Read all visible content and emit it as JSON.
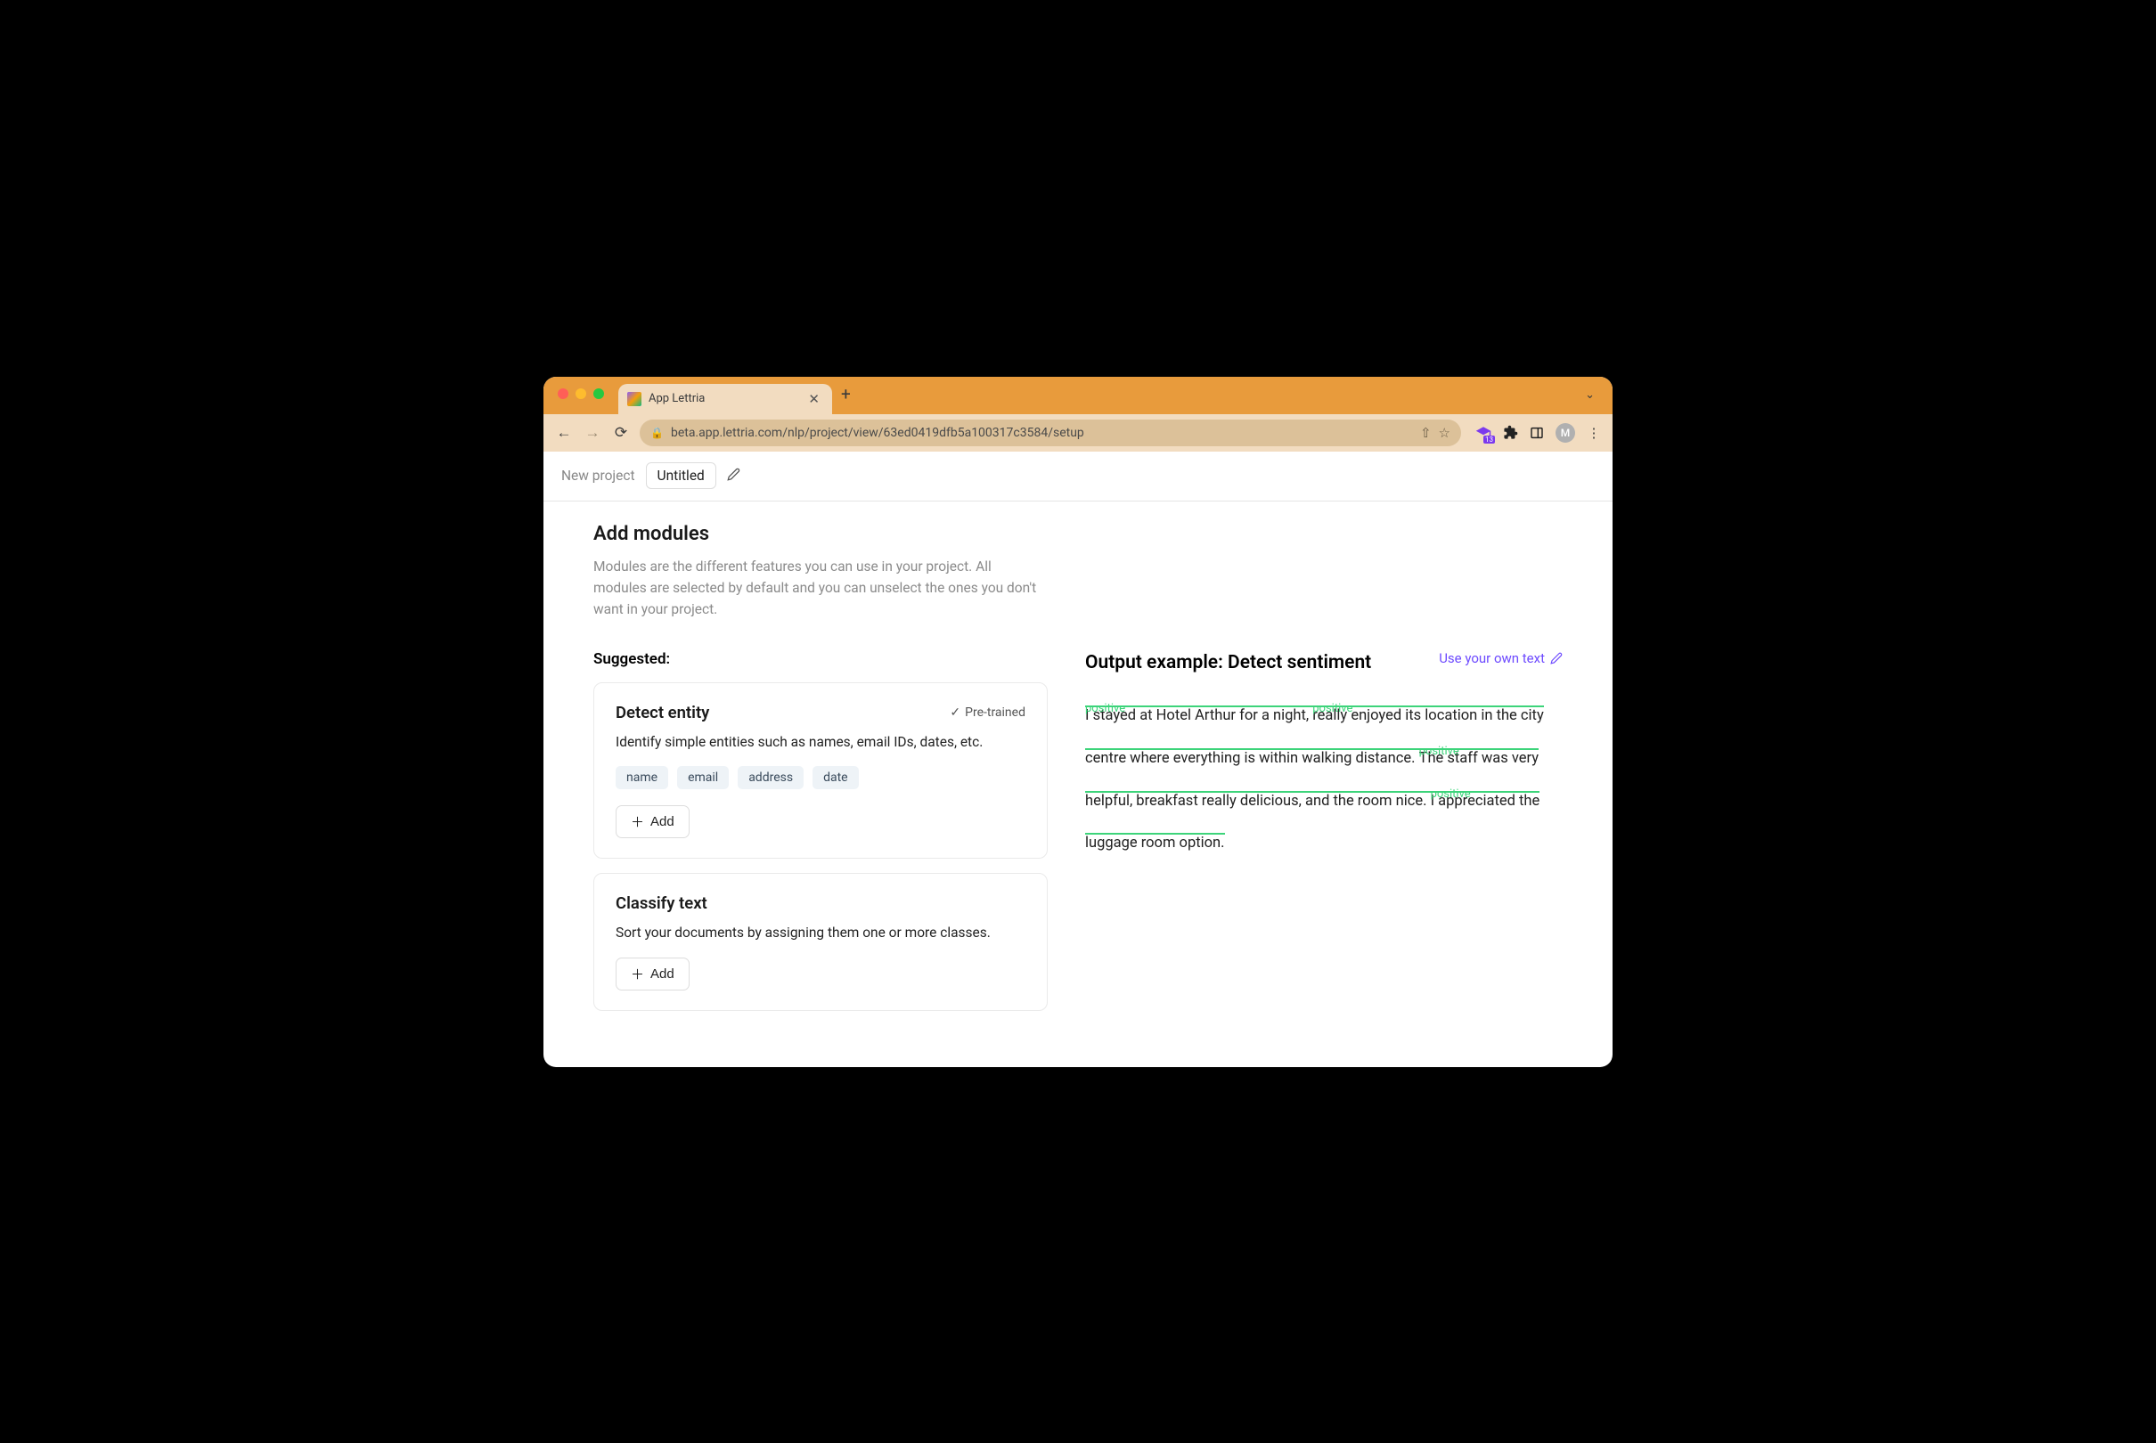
{
  "browser": {
    "tab_title": "App Lettria",
    "url": "beta.app.lettria.com/nlp/project/view/63ed0419dfb5a100317c3584/setup",
    "avatar_letter": "M"
  },
  "header": {
    "breadcrumb": "New project",
    "project_name": "Untitled"
  },
  "page": {
    "title": "Add modules",
    "description": "Modules are the different features you can use in your project. All modules are selected by default and you can unselect the ones you don't want in your project.",
    "suggested_label": "Suggested:"
  },
  "modules": [
    {
      "title": "Detect entity",
      "pretrained": true,
      "pretrained_label": "Pre-trained",
      "description": "Identify simple entities such as names, email IDs, dates, etc.",
      "tags": [
        "name",
        "email",
        "address",
        "date"
      ],
      "add_label": "Add"
    },
    {
      "title": "Classify text",
      "pretrained": false,
      "description": "Sort your documents by assigning them one or more classes.",
      "tags": [],
      "add_label": "Add"
    }
  ],
  "output": {
    "title": "Output example: Detect sentiment",
    "use_own_label": "Use your own text",
    "sentiment_label": "positive",
    "segments": [
      {
        "text": "I stayed at Hotel Arthur for a night, ",
        "hl": true,
        "label": "positive"
      },
      {
        "text": "really enjoyed its location in the city centre where everything is within walking distance. ",
        "hl": true,
        "label": "positive"
      },
      {
        "text": "The staff was very helpful, breakfast really delicious, and the room nice. ",
        "hl": true,
        "label": "positive"
      },
      {
        "text": "I appreciated the luggage room option.",
        "hl": true,
        "label": "positive"
      }
    ]
  }
}
